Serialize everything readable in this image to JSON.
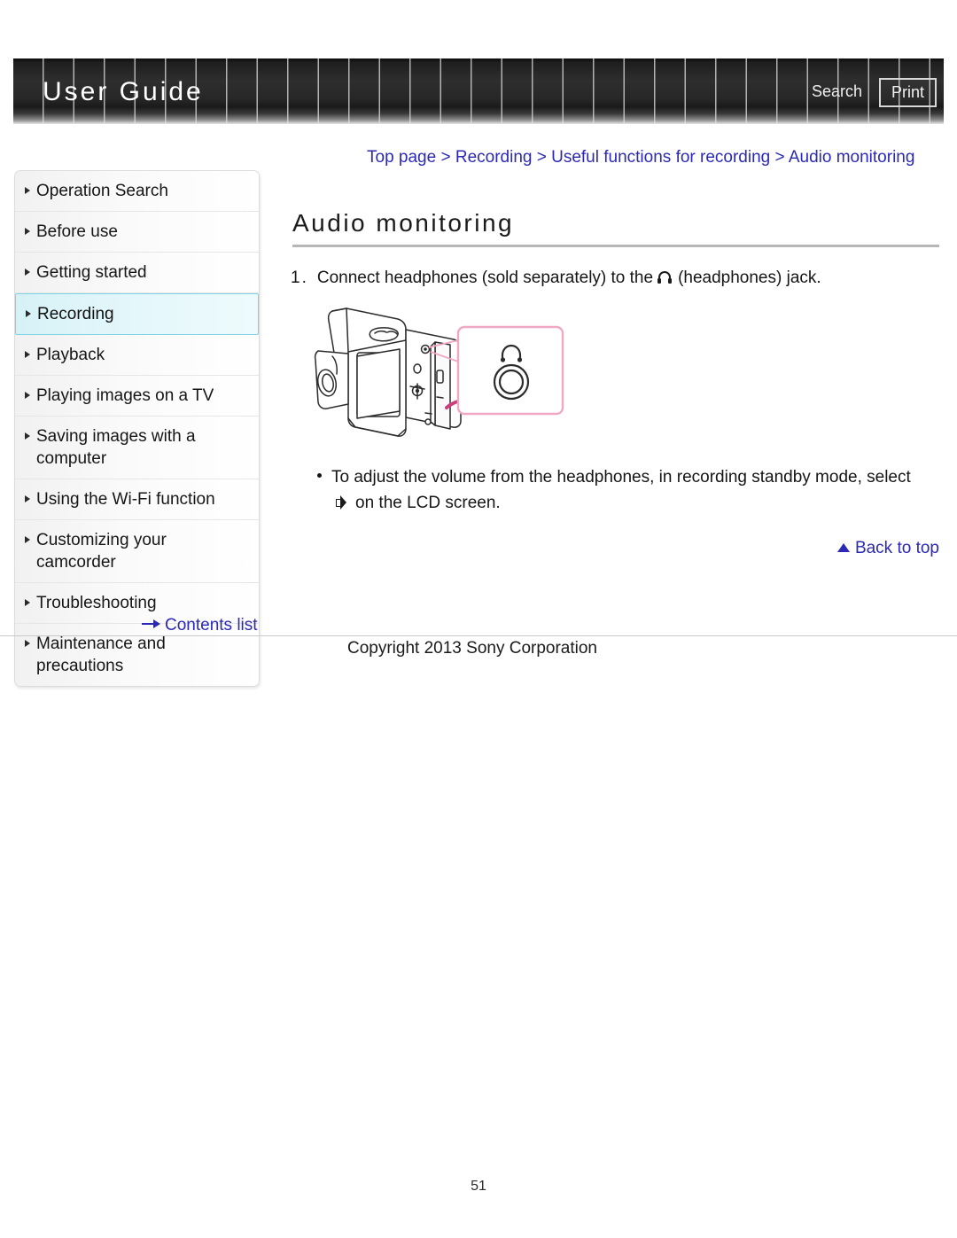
{
  "header": {
    "title": "User Guide",
    "search_label": "Search",
    "print_label": "Print"
  },
  "breadcrumb": {
    "separator": ">",
    "items": [
      {
        "label": "Top page"
      },
      {
        "label": "Recording"
      },
      {
        "label": "Useful functions for recording"
      },
      {
        "label": "Audio monitoring"
      }
    ]
  },
  "sidebar": {
    "items": [
      {
        "label": "Operation Search",
        "active": false
      },
      {
        "label": "Before use",
        "active": false
      },
      {
        "label": "Getting started",
        "active": false
      },
      {
        "label": "Recording",
        "active": true
      },
      {
        "label": "Playback",
        "active": false
      },
      {
        "label": "Playing images on a TV",
        "active": false
      },
      {
        "label": "Saving images with a computer",
        "active": false
      },
      {
        "label": "Using the Wi-Fi function",
        "active": false
      },
      {
        "label": "Customizing your camcorder",
        "active": false
      },
      {
        "label": "Troubleshooting",
        "active": false
      },
      {
        "label": "Maintenance and precautions",
        "active": false
      }
    ],
    "contents_list_label": "Contents list"
  },
  "main": {
    "heading": "Audio monitoring",
    "step": {
      "number": "1.",
      "text_before_icon": "Connect headphones (sold separately) to the",
      "icon": "headphones-icon",
      "text_after_icon": "(headphones) jack."
    },
    "illustration": {
      "name": "camcorder-headphone-jack-illustration",
      "callout_icon": "headphones-jack-icon",
      "callout_border_color": "#f0a7c4",
      "arrow_color": "#cc3f7d"
    },
    "note": {
      "bullet": "•",
      "text_before_icon": "To adjust the volume from the headphones, in recording standby mode, select",
      "icon": "speaker-volume-icon",
      "text_after_icon": "on the LCD screen."
    },
    "back_to_top_label": "Back to top"
  },
  "footer": {
    "copyright": "Copyright 2013 Sony Corporation",
    "page_number": "51"
  },
  "colors": {
    "link_blue": "#2b29b5",
    "header_dark": "#1e1e1e",
    "active_sidebar": "#d6f2f7",
    "heading_rule": "#b6b6b6"
  }
}
